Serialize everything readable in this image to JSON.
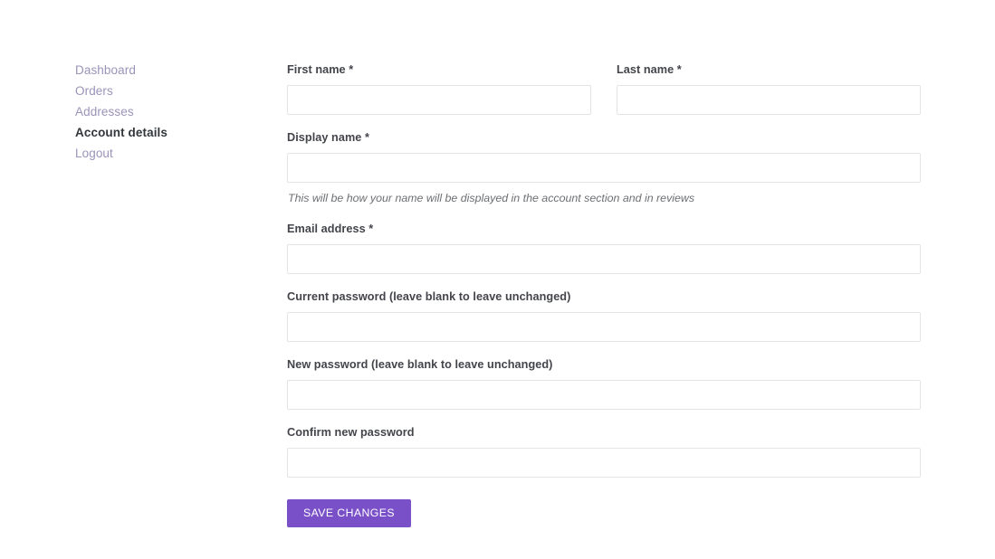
{
  "colors": {
    "accent": "#7950c8",
    "nav_link": "#9b93b8",
    "nav_active": "#32373c",
    "label": "#43454b",
    "input_border": "#e4e4e4",
    "helper_text": "#6d6f72",
    "page_background": "#ffffff"
  },
  "sidebar": {
    "items": [
      {
        "label": "Dashboard",
        "active": false
      },
      {
        "label": "Orders",
        "active": false
      },
      {
        "label": "Addresses",
        "active": false
      },
      {
        "label": "Account details",
        "active": true
      },
      {
        "label": "Logout",
        "active": false
      }
    ]
  },
  "form": {
    "first_name": {
      "label": "First name *",
      "value": "",
      "placeholder": ""
    },
    "last_name": {
      "label": "Last name *",
      "value": "",
      "placeholder": ""
    },
    "display_name": {
      "label": "Display name *",
      "value": "",
      "placeholder": "",
      "helper": "This will be how your name will be displayed in the account section and in reviews"
    },
    "email": {
      "label": "Email address *",
      "value": "",
      "placeholder": ""
    },
    "current_password": {
      "label": "Current password (leave blank to leave unchanged)",
      "value": "",
      "placeholder": ""
    },
    "new_password": {
      "label": "New password (leave blank to leave unchanged)",
      "value": "",
      "placeholder": ""
    },
    "confirm_password": {
      "label": "Confirm new password",
      "value": "",
      "placeholder": ""
    },
    "submit": {
      "label": "SAVE CHANGES"
    }
  }
}
